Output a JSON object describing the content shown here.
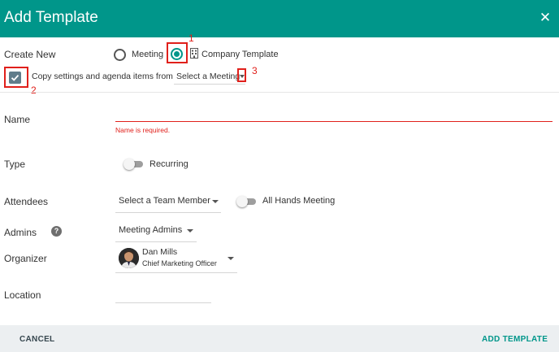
{
  "dialog": {
    "title": "Add Template",
    "close_icon": "close-icon"
  },
  "create_new": {
    "label": "Create New",
    "options": [
      {
        "label": "Meeting",
        "selected": false
      },
      {
        "label": "Company Template",
        "selected": true,
        "icon": "building-icon"
      }
    ]
  },
  "copy_settings": {
    "checked": true,
    "label": "Copy settings and agenda items from",
    "select_value": "Select a Meeting"
  },
  "annotations": [
    "1",
    "2",
    "3"
  ],
  "name": {
    "label": "Name",
    "value": "",
    "error": "Name is required."
  },
  "type": {
    "label": "Type",
    "toggle_label": "Recurring",
    "on": false
  },
  "attendees": {
    "label": "Attendees",
    "select_value": "Select a Team Member",
    "toggle_label": "All Hands Meeting",
    "toggle_on": false
  },
  "admins": {
    "label": "Admins",
    "help_icon": "question-icon",
    "select_value": "Meeting Admins"
  },
  "organizer": {
    "label": "Organizer",
    "name": "Dan Mills",
    "role": "Chief Marketing Officer"
  },
  "location": {
    "label": "Location",
    "value": ""
  },
  "footer": {
    "cancel_label": "CANCEL",
    "add_label": "ADD TEMPLATE"
  },
  "colors": {
    "accent": "#00968a",
    "error": "#e0201b",
    "footer_bg": "#eceff1",
    "checkbox": "#607d8b"
  }
}
